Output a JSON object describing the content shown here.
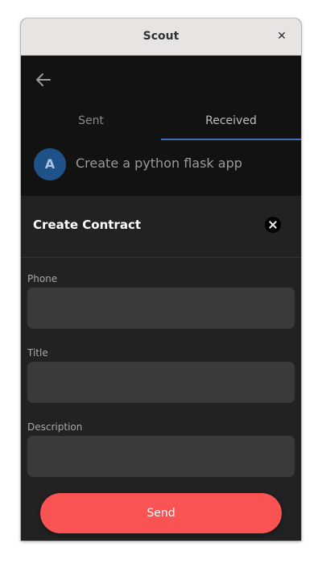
{
  "window": {
    "title": "Scout",
    "close_glyph": "✕"
  },
  "header": {
    "back_icon": "arrow-left-icon"
  },
  "tabs": [
    {
      "label": "Sent",
      "active": false
    },
    {
      "label": "Received",
      "active": true
    }
  ],
  "messages": [
    {
      "avatar_letter": "A",
      "text": "Create a python flask app"
    }
  ],
  "dialog": {
    "title": "Create Contract",
    "close_icon": "close-circle-icon",
    "fields": [
      {
        "label": "Phone",
        "value": ""
      },
      {
        "label": "Title",
        "value": ""
      },
      {
        "label": "Description",
        "value": ""
      }
    ],
    "send_label": "Send"
  },
  "colors": {
    "accent": "#fa5353",
    "tab_indicator": "#3f6fb3",
    "avatar_bg": "#1f5289",
    "background": "#121212",
    "sheet_bg": "#222222",
    "input_bg": "#3a3a3a"
  }
}
